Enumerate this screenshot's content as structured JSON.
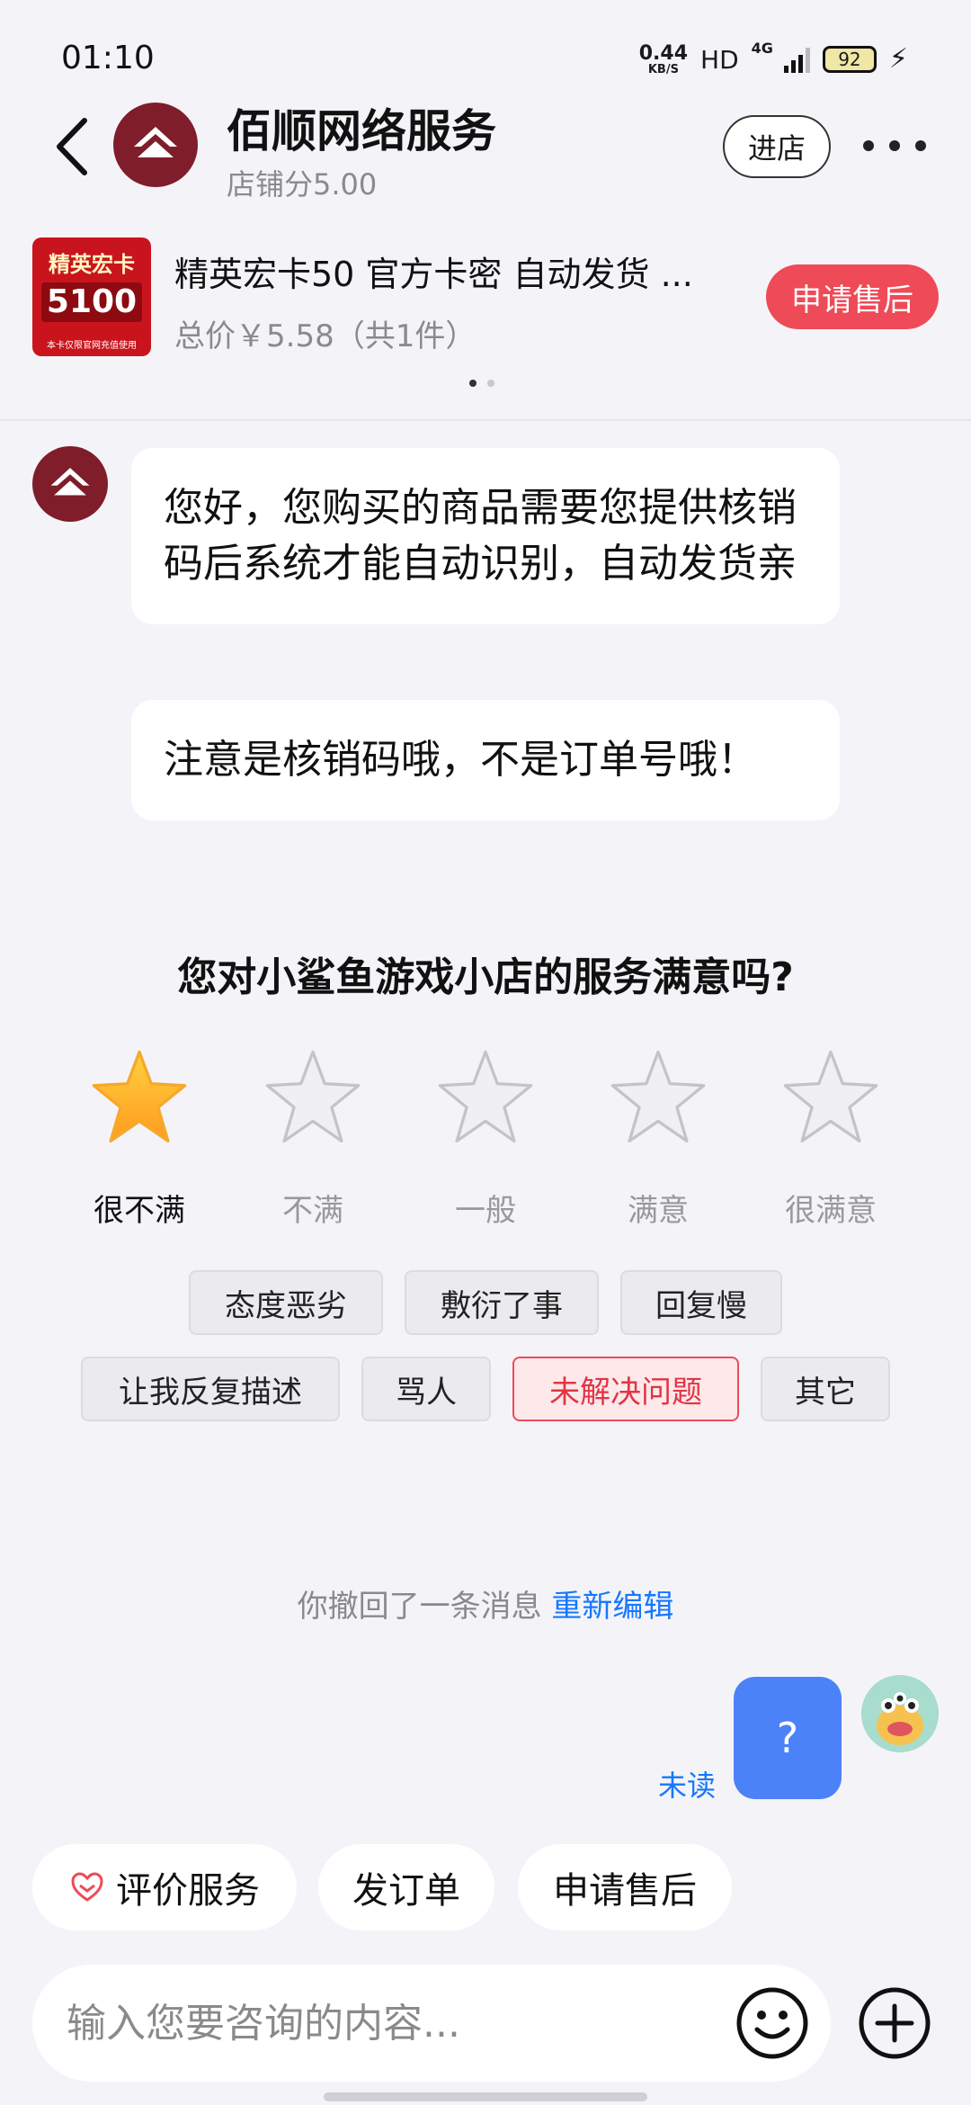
{
  "status_bar": {
    "time": "01:10",
    "net_speed": "0.44",
    "net_unit": "KB/S",
    "hd": "HD",
    "network": "4G",
    "battery": "92"
  },
  "header": {
    "shop_name": "佰顺网络服务",
    "shop_score": "店铺分5.00",
    "enter_store": "进店"
  },
  "product": {
    "title": "精英宏卡50 官方卡密 自动发货 ...",
    "price": "总价￥5.58（共1件）",
    "after_sale": "申请售后",
    "thumb_title": "精英宏卡",
    "thumb_value": "5100",
    "thumb_note": "本卡仅限官网充值使用"
  },
  "messages": [
    {
      "text": "您好，您购买的商品需要您提供核销码后系统才能自动识别，自动发货亲"
    },
    {
      "text": "注意是核销码哦，不是订单号哦！"
    }
  ],
  "survey": {
    "question": "您对小鲨鱼游戏小店的服务满意吗?",
    "rating": 1,
    "max_rating": 5,
    "labels": [
      "很不满",
      "不满",
      "一般",
      "满意",
      "很满意"
    ],
    "tags_row1": [
      "态度恶劣",
      "敷衍了事",
      "回复慢"
    ],
    "tags_row2": [
      "让我反复描述",
      "骂人",
      "未解决问题",
      "其它"
    ],
    "selected_tag": "未解决问题"
  },
  "recall": {
    "text": "你撤回了一条消息",
    "action": "重新编辑"
  },
  "user_message": {
    "text": "?",
    "status": "未读"
  },
  "quick_actions": {
    "rate": "评价服务",
    "send_order": "发订单",
    "after_sale": "申请售后"
  },
  "input": {
    "placeholder": "输入您要咨询的内容..."
  },
  "colors": {
    "brand_red": "#ef4a57",
    "link_blue": "#1677ff",
    "user_bubble": "#4c82f7",
    "shop_avatar": "#7f1d2a"
  }
}
